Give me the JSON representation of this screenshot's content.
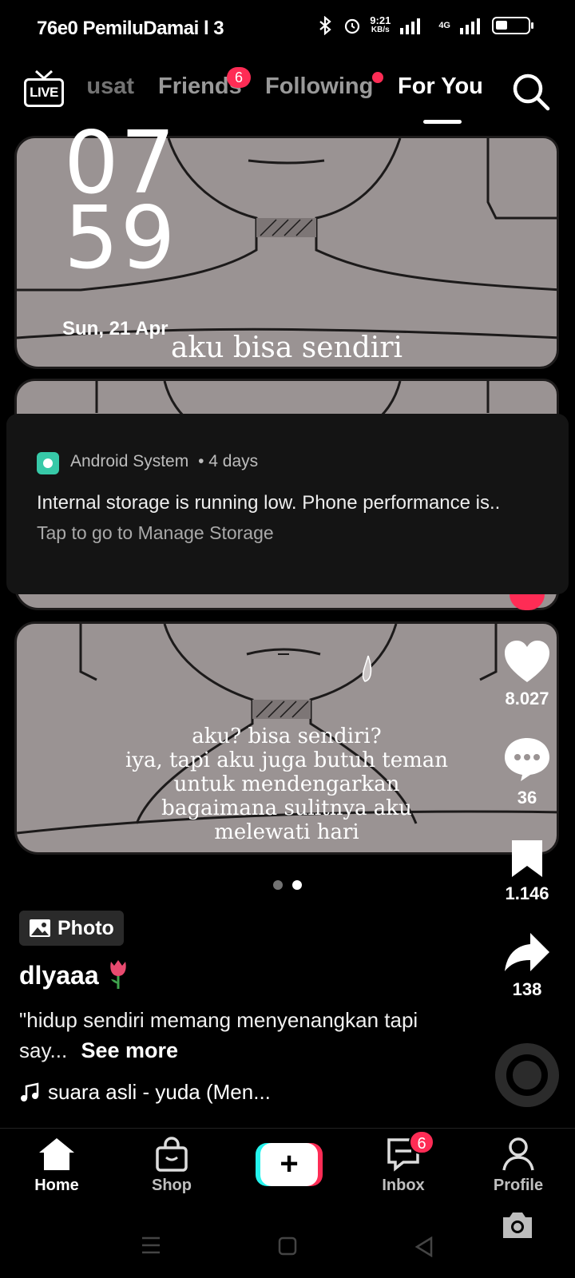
{
  "status_bar": {
    "left_text": "76e0 PemiluDamai l 3",
    "time_small": "9:21",
    "net_speed": "KB/s",
    "network": "4G"
  },
  "top_nav": {
    "live_label": "LIVE",
    "tabs": [
      {
        "label": "Pusat",
        "clipped_text": "usat"
      },
      {
        "label": "Friends",
        "badge": "6"
      },
      {
        "label": "Following",
        "dot": true
      },
      {
        "label": "For You",
        "active": true
      }
    ]
  },
  "lock_overlay": {
    "hour": "07",
    "minute": "59",
    "date": "Sun, 21 Apr"
  },
  "post": {
    "panel1_text": "aku bisa sendiri",
    "panel3_lines": [
      "aku? bisa sendiri?",
      "iya, tapi aku juga butuh teman",
      "untuk mendengarkan",
      "bagaimana sulitnya aku",
      "melewati hari"
    ],
    "carousel_index": 2,
    "carousel_count": 2
  },
  "notification": {
    "source": "Android System",
    "age": "• 4 days",
    "title": "Internal storage is running low. Phone performance is..",
    "subtitle": "Tap to go to Manage Storage",
    "icon": "android-storage-icon"
  },
  "actions": {
    "likes": "8.027",
    "comments": "36",
    "bookmarks": "1.146",
    "shares": "138"
  },
  "caption": {
    "badge": "Photo",
    "username": "dlyaaa",
    "text": "\"hidup sendiri memang menyenangkan tapi say...",
    "see_more": "See more",
    "music": "suara asli - yuda (Men..."
  },
  "bottom_nav": {
    "items": [
      {
        "label": "Home",
        "icon": "home-icon",
        "active": true
      },
      {
        "label": "Shop",
        "icon": "shop-bag-icon"
      },
      {
        "label": "+",
        "icon": "create-icon"
      },
      {
        "label": "Inbox",
        "icon": "inbox-icon",
        "badge": "6"
      },
      {
        "label": "Profile",
        "icon": "profile-icon"
      }
    ]
  },
  "colors": {
    "accent_red": "#fe2c55",
    "accent_cyan": "#25f4ee",
    "panel_gray": "#9a9393",
    "notif_bg": "#141414"
  }
}
